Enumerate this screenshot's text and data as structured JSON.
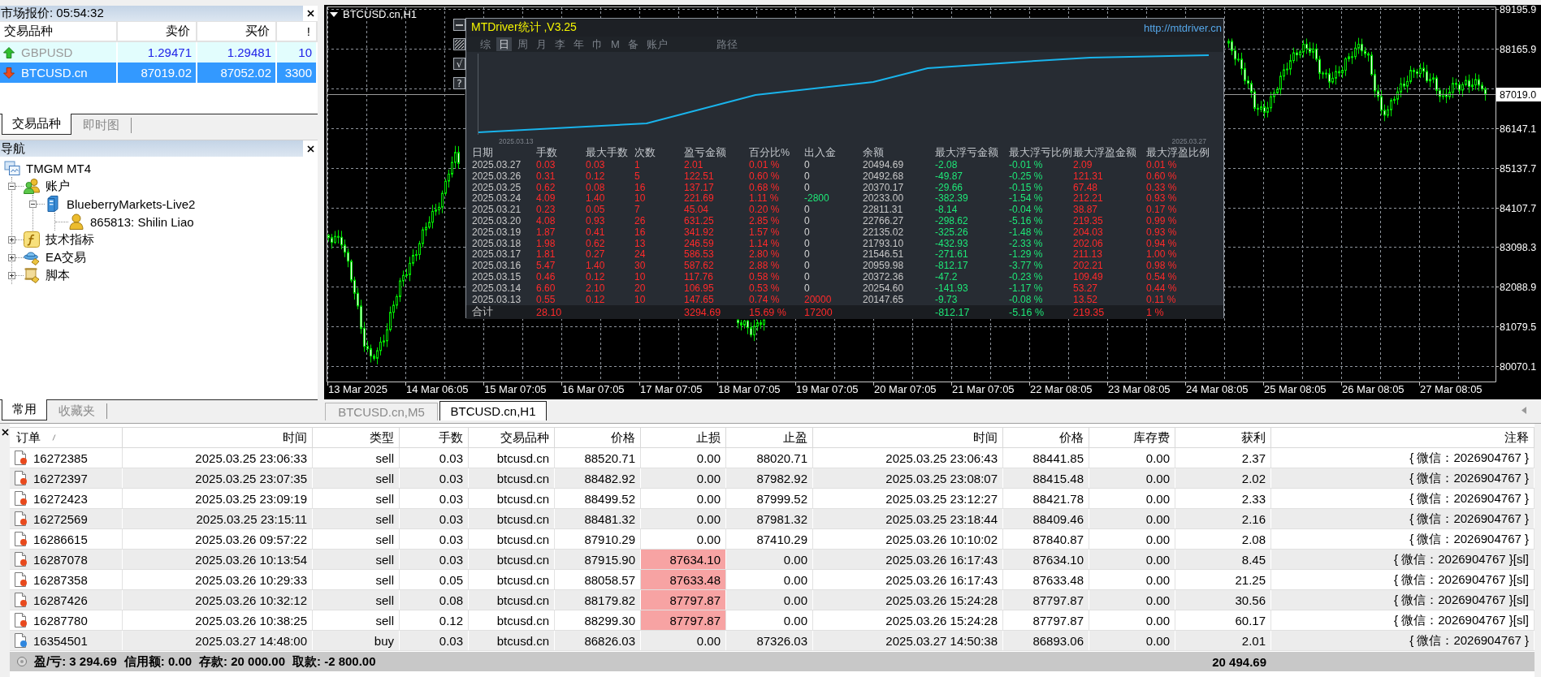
{
  "market_watch": {
    "title": "市场报价: 05:54:32",
    "columns": [
      "交易品种",
      "卖价",
      "买价",
      "!"
    ],
    "rows": [
      {
        "symbol": "GBPUSD",
        "bid": "1.29471",
        "ask": "1.29481",
        "spread": "10",
        "kind": "up",
        "selected": false
      },
      {
        "symbol": "BTCUSD.cn",
        "bid": "87019.02",
        "ask": "87052.02",
        "spread": "3300",
        "kind": "down",
        "selected": true
      }
    ],
    "tabs": [
      {
        "label": "交易品种",
        "selected": true
      },
      {
        "label": "即时图",
        "selected": false
      }
    ]
  },
  "navigator": {
    "title": "导航",
    "tree": [
      {
        "label": "TMGM MT4",
        "kind": "terminal",
        "children": [
          {
            "label": "账户",
            "kind": "accounts",
            "expanded": true,
            "children": [
              {
                "label": "BlueberryMarkets-Live2",
                "kind": "server",
                "expanded": true,
                "children": [
                  {
                    "label": "865813: Shilin Liao",
                    "kind": "account"
                  }
                ]
              }
            ]
          },
          {
            "label": "技术指标",
            "kind": "indicators",
            "expanded": false
          },
          {
            "label": "EA交易",
            "kind": "experts",
            "expanded": false
          },
          {
            "label": "脚本",
            "kind": "scripts",
            "expanded": false
          }
        ]
      }
    ],
    "tabs": [
      {
        "label": "常用",
        "selected": true
      },
      {
        "label": "收藏夹",
        "selected": false
      }
    ]
  },
  "chart": {
    "title": "BTCUSD.cn,H1",
    "side_buttons": [
      {
        "kind": "minimize"
      },
      {
        "kind": "pattern"
      },
      {
        "kind": "check",
        "label": "√"
      },
      {
        "kind": "help",
        "label": "?"
      }
    ],
    "price_labels": [
      "89195.9",
      "88165.9",
      "86147.1",
      "85137.7",
      "84107.7",
      "83098.3",
      "82088.9",
      "81079.5",
      "80070.1"
    ],
    "current_price": "87019.0",
    "time_labels": [
      "13 Mar 2025",
      "14 Mar 06:05",
      "15 Mar 07:05",
      "16 Mar 07:05",
      "17 Mar 07:05",
      "18 Mar 07:05",
      "19 Mar 07:05",
      "20 Mar 07:05",
      "21 Mar 07:05",
      "22 Mar 08:05",
      "23 Mar 08:05",
      "24 Mar 08:05",
      "25 Mar 08:05",
      "26 Mar 08:05",
      "27 Mar 08:05"
    ],
    "stats_panel": {
      "title": "MTDriver统计 ,V3.25",
      "link": "http://mtdriver.cn",
      "tabs": [
        {
          "label": "综",
          "selected": false
        },
        {
          "label": "日",
          "selected": true
        },
        {
          "label": "周",
          "selected": false
        },
        {
          "label": "月",
          "selected": false
        },
        {
          "label": "李",
          "selected": false
        },
        {
          "label": "年",
          "selected": false
        },
        {
          "label": "巾",
          "selected": false
        },
        {
          "label": "M",
          "selected": false
        },
        {
          "label": "备",
          "selected": false
        },
        {
          "label": "账户",
          "selected": false
        },
        {
          "label": "路径",
          "selected": false
        }
      ],
      "equity_curve": {
        "start_label": "2025.03.13",
        "end_label": "2025.03.27"
      },
      "columns": [
        "日期",
        "手数",
        "最大手数",
        "次数",
        "盈亏金额",
        "百分比%",
        "出入金",
        "余额",
        "最大浮亏金额",
        "最大浮亏比例",
        "最大浮盈金额",
        "最大浮盈比例"
      ],
      "rows": [
        {
          "date": "2025.03.27",
          "lots": "0.03",
          "max_lots": "0.03",
          "trades": "1",
          "pnl": "2.01",
          "pnl_pct": "0.01 %",
          "flow": {
            "text": "0",
            "color": "#d4d4d4"
          },
          "balance": "20494.69",
          "max_float_loss": "-2.08",
          "max_float_loss_pct": "-0.01 %",
          "max_float_profit": "2.09",
          "max_float_profit_pct": "0.01 %"
        },
        {
          "date": "2025.03.26",
          "lots": "0.31",
          "max_lots": "0.12",
          "trades": "5",
          "pnl": "122.51",
          "pnl_pct": "0.60 %",
          "flow": {
            "text": "0",
            "color": "#d4d4d4"
          },
          "balance": "20492.68",
          "max_float_loss": "-49.87",
          "max_float_loss_pct": "-0.25 %",
          "max_float_profit": "121.31",
          "max_float_profit_pct": "0.60 %"
        },
        {
          "date": "2025.03.25",
          "lots": "0.62",
          "max_lots": "0.08",
          "trades": "16",
          "pnl": "137.17",
          "pnl_pct": "0.68 %",
          "flow": {
            "text": "0",
            "color": "#d4d4d4"
          },
          "balance": "20370.17",
          "max_float_loss": "-29.66",
          "max_float_loss_pct": "-0.15 %",
          "max_float_profit": "67.48",
          "max_float_profit_pct": "0.33 %"
        },
        {
          "date": "2025.03.24",
          "lots": "4.09",
          "max_lots": "1.40",
          "trades": "10",
          "pnl": "221.69",
          "pnl_pct": "1.11 %",
          "flow": {
            "text": "-2800",
            "color": "#1ee878"
          },
          "balance": "20233.00",
          "max_float_loss": "-382.39",
          "max_float_loss_pct": "-1.54 %",
          "max_float_profit": "212.21",
          "max_float_profit_pct": "0.93 %"
        },
        {
          "date": "2025.03.21",
          "lots": "0.23",
          "max_lots": "0.05",
          "trades": "7",
          "pnl": "45.04",
          "pnl_pct": "0.20 %",
          "flow": {
            "text": "0",
            "color": "#d4d4d4"
          },
          "balance": "22811.31",
          "max_float_loss": "-8.14",
          "max_float_loss_pct": "-0.04 %",
          "max_float_profit": "38.87",
          "max_float_profit_pct": "0.17 %"
        },
        {
          "date": "2025.03.20",
          "lots": "4.08",
          "max_lots": "0.93",
          "trades": "26",
          "pnl": "631.25",
          "pnl_pct": "2.85 %",
          "flow": {
            "text": "0",
            "color": "#d4d4d4"
          },
          "balance": "22766.27",
          "max_float_loss": "-298.62",
          "max_float_loss_pct": "-5.16 %",
          "max_float_profit": "219.35",
          "max_float_profit_pct": "0.99 %"
        },
        {
          "date": "2025.03.19",
          "lots": "1.87",
          "max_lots": "0.41",
          "trades": "16",
          "pnl": "341.92",
          "pnl_pct": "1.57 %",
          "flow": {
            "text": "0",
            "color": "#d4d4d4"
          },
          "balance": "22135.02",
          "max_float_loss": "-325.26",
          "max_float_loss_pct": "-1.48 %",
          "max_float_profit": "204.03",
          "max_float_profit_pct": "0.93 %"
        },
        {
          "date": "2025.03.18",
          "lots": "1.98",
          "max_lots": "0.62",
          "trades": "13",
          "pnl": "246.59",
          "pnl_pct": "1.14 %",
          "flow": {
            "text": "0",
            "color": "#d4d4d4"
          },
          "balance": "21793.10",
          "max_float_loss": "-432.93",
          "max_float_loss_pct": "-2.33 %",
          "max_float_profit": "202.06",
          "max_float_profit_pct": "0.94 %"
        },
        {
          "date": "2025.03.17",
          "lots": "1.81",
          "max_lots": "0.27",
          "trades": "24",
          "pnl": "586.53",
          "pnl_pct": "2.80 %",
          "flow": {
            "text": "0",
            "color": "#d4d4d4"
          },
          "balance": "21546.51",
          "max_float_loss": "-271.61",
          "max_float_loss_pct": "-1.29 %",
          "max_float_profit": "211.13",
          "max_float_profit_pct": "1.00 %"
        },
        {
          "date": "2025.03.16",
          "lots": "5.47",
          "max_lots": "1.40",
          "trades": "30",
          "pnl": "587.62",
          "pnl_pct": "2.88 %",
          "flow": {
            "text": "0",
            "color": "#d4d4d4"
          },
          "balance": "20959.98",
          "max_float_loss": "-812.17",
          "max_float_loss_pct": "-3.77 %",
          "max_float_profit": "202.21",
          "max_float_profit_pct": "0.98 %"
        },
        {
          "date": "2025.03.15",
          "lots": "0.46",
          "max_lots": "0.12",
          "trades": "10",
          "pnl": "117.76",
          "pnl_pct": "0.58 %",
          "flow": {
            "text": "0",
            "color": "#d4d4d4"
          },
          "balance": "20372.36",
          "max_float_loss": "-47.2",
          "max_float_loss_pct": "-0.23 %",
          "max_float_profit": "109.49",
          "max_float_profit_pct": "0.54 %"
        },
        {
          "date": "2025.03.14",
          "lots": "6.60",
          "max_lots": "2.10",
          "trades": "20",
          "pnl": "106.95",
          "pnl_pct": "0.53 %",
          "flow": {
            "text": "0",
            "color": "#d4d4d4"
          },
          "balance": "20254.60",
          "max_float_loss": "-141.93",
          "max_float_loss_pct": "-1.17 %",
          "max_float_profit": "53.27",
          "max_float_profit_pct": "0.44 %"
        },
        {
          "date": "2025.03.13",
          "lots": "0.55",
          "max_lots": "0.12",
          "trades": "10",
          "pnl": "147.65",
          "pnl_pct": "0.74 %",
          "flow": {
            "text": "20000",
            "color": "#ff2a2a"
          },
          "balance": "20147.65",
          "max_float_loss": "-9.73",
          "max_float_loss_pct": "-0.08 %",
          "max_float_profit": "13.52",
          "max_float_profit_pct": "0.11 %"
        }
      ],
      "total": {
        "label": "合计",
        "lots": "28.10",
        "pnl": "3294.69",
        "pnl_pct": "15.69 %",
        "flow": {
          "text": "17200",
          "color": "#ff2a2a"
        },
        "max_float_loss": "-812.17",
        "max_float_loss_pct": "-5.16 %",
        "max_float_profit": "219.35",
        "max_float_profit_pct": "1 %"
      }
    }
  },
  "chart_tabs": [
    {
      "label": "BTCUSD.cn,M5",
      "selected": false
    },
    {
      "label": "BTCUSD.cn,H1",
      "selected": true
    }
  ],
  "orders": {
    "columns": [
      "订单",
      "时间",
      "类型",
      "手数",
      "交易品种",
      "价格",
      "止损",
      "止盈",
      "时间",
      "价格",
      "库存费",
      "获利",
      "注释"
    ],
    "rows": [
      {
        "color": "#e8491d",
        "stop_loss_hit": false,
        "cells": [
          "16272385",
          "2025.03.25 23:06:33",
          "sell",
          "0.03",
          "btcusd.cn",
          "88520.71",
          "0.00",
          "88020.71",
          "2025.03.25 23:06:43",
          "88441.85",
          "0.00",
          "2.37",
          "{ 微信：2026904767 }"
        ]
      },
      {
        "color": "#e8491d",
        "stop_loss_hit": false,
        "cells": [
          "16272397",
          "2025.03.25 23:07:35",
          "sell",
          "0.03",
          "btcusd.cn",
          "88482.92",
          "0.00",
          "87982.92",
          "2025.03.25 23:08:07",
          "88415.48",
          "0.00",
          "2.02",
          "{ 微信：2026904767 }"
        ]
      },
      {
        "color": "#e8491d",
        "stop_loss_hit": false,
        "cells": [
          "16272423",
          "2025.03.25 23:09:19",
          "sell",
          "0.03",
          "btcusd.cn",
          "88499.52",
          "0.00",
          "87999.52",
          "2025.03.25 23:12:27",
          "88421.78",
          "0.00",
          "2.33",
          "{ 微信：2026904767 }"
        ]
      },
      {
        "color": "#e8491d",
        "stop_loss_hit": false,
        "cells": [
          "16272569",
          "2025.03.25 23:15:11",
          "sell",
          "0.03",
          "btcusd.cn",
          "88481.32",
          "0.00",
          "87981.32",
          "2025.03.25 23:18:44",
          "88409.46",
          "0.00",
          "2.16",
          "{ 微信：2026904767 }"
        ]
      },
      {
        "color": "#e8491d",
        "stop_loss_hit": false,
        "cells": [
          "16286615",
          "2025.03.26 09:57:22",
          "sell",
          "0.03",
          "btcusd.cn",
          "87910.29",
          "0.00",
          "87410.29",
          "2025.03.26 10:10:02",
          "87840.87",
          "0.00",
          "2.08",
          "{ 微信：2026904767 }"
        ]
      },
      {
        "color": "#e8491d",
        "stop_loss_hit": true,
        "cells": [
          "16287078",
          "2025.03.26 10:13:54",
          "sell",
          "0.03",
          "btcusd.cn",
          "87915.90",
          "87634.10",
          "0.00",
          "2025.03.26 16:17:43",
          "87634.10",
          "0.00",
          "8.45",
          "{ 微信：2026904767 }[sl]"
        ]
      },
      {
        "color": "#e8491d",
        "stop_loss_hit": true,
        "cells": [
          "16287358",
          "2025.03.26 10:29:33",
          "sell",
          "0.05",
          "btcusd.cn",
          "88058.57",
          "87633.48",
          "0.00",
          "2025.03.26 16:17:43",
          "87633.48",
          "0.00",
          "21.25",
          "{ 微信：2026904767 }[sl]"
        ]
      },
      {
        "color": "#e8491d",
        "stop_loss_hit": true,
        "cells": [
          "16287426",
          "2025.03.26 10:32:12",
          "sell",
          "0.08",
          "btcusd.cn",
          "88179.82",
          "87797.87",
          "0.00",
          "2025.03.26 15:24:28",
          "87797.87",
          "0.00",
          "30.56",
          "{ 微信：2026904767 }[sl]"
        ]
      },
      {
        "color": "#e8491d",
        "stop_loss_hit": true,
        "cells": [
          "16287780",
          "2025.03.26 10:38:25",
          "sell",
          "0.12",
          "btcusd.cn",
          "88299.30",
          "87797.87",
          "0.00",
          "2025.03.26 15:24:28",
          "87797.87",
          "0.00",
          "60.17",
          "{ 微信：2026904767 }[sl]"
        ]
      },
      {
        "color": "#2e86de",
        "stop_loss_hit": false,
        "cells": [
          "16354501",
          "2025.03.27 14:48:00",
          "buy",
          "0.03",
          "btcusd.cn",
          "86826.03",
          "0.00",
          "87326.03",
          "2025.03.27 14:50:38",
          "86893.06",
          "0.00",
          "2.01",
          "{ 微信：2026904767 }"
        ]
      }
    ],
    "summary": {
      "items": [
        "盈/亏: 3 294.69",
        "信用额: 0.00",
        "存款: 20 000.00",
        "取款: -2 800.00"
      ],
      "total": "20 494.69"
    }
  }
}
